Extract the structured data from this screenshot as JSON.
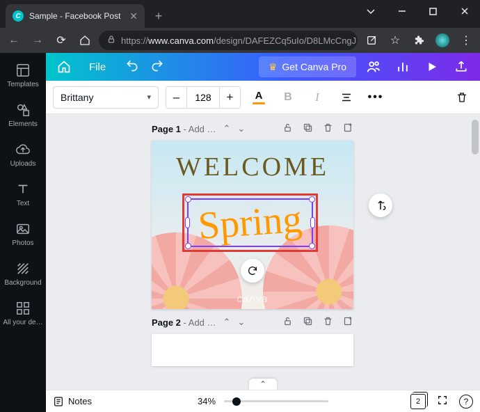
{
  "browser": {
    "tab_title": "Sample - Facebook Post",
    "url_prefix": "https://",
    "url_host": "www.canva.com",
    "url_path": "/design/DAFEZCq5uIo/D8LMcCngJ..."
  },
  "canva_top": {
    "file_label": "File",
    "get_pro_label": "Get Canva Pro"
  },
  "toolbar": {
    "font_name": "Brittany",
    "font_size": "128",
    "minus": "–",
    "plus": "+",
    "text_color_letter": "A",
    "bold_letter": "B",
    "italic_letter": "I",
    "more": "•••"
  },
  "sidebar": {
    "items": [
      {
        "label": "Templates"
      },
      {
        "label": "Elements"
      },
      {
        "label": "Uploads"
      },
      {
        "label": "Text"
      },
      {
        "label": "Photos"
      },
      {
        "label": "Background"
      },
      {
        "label": "All your de…"
      }
    ]
  },
  "pages": {
    "p1_title": "Page 1",
    "p1_hint": "- Add …",
    "p2_title": "Page 2",
    "p2_hint": "- Add …",
    "welcome_text": "WELCOME",
    "spring_text": "Spring",
    "watermark": "canva"
  },
  "bottom": {
    "notes_label": "Notes",
    "zoom_label": "34%",
    "page_count": "2",
    "help": "?"
  }
}
